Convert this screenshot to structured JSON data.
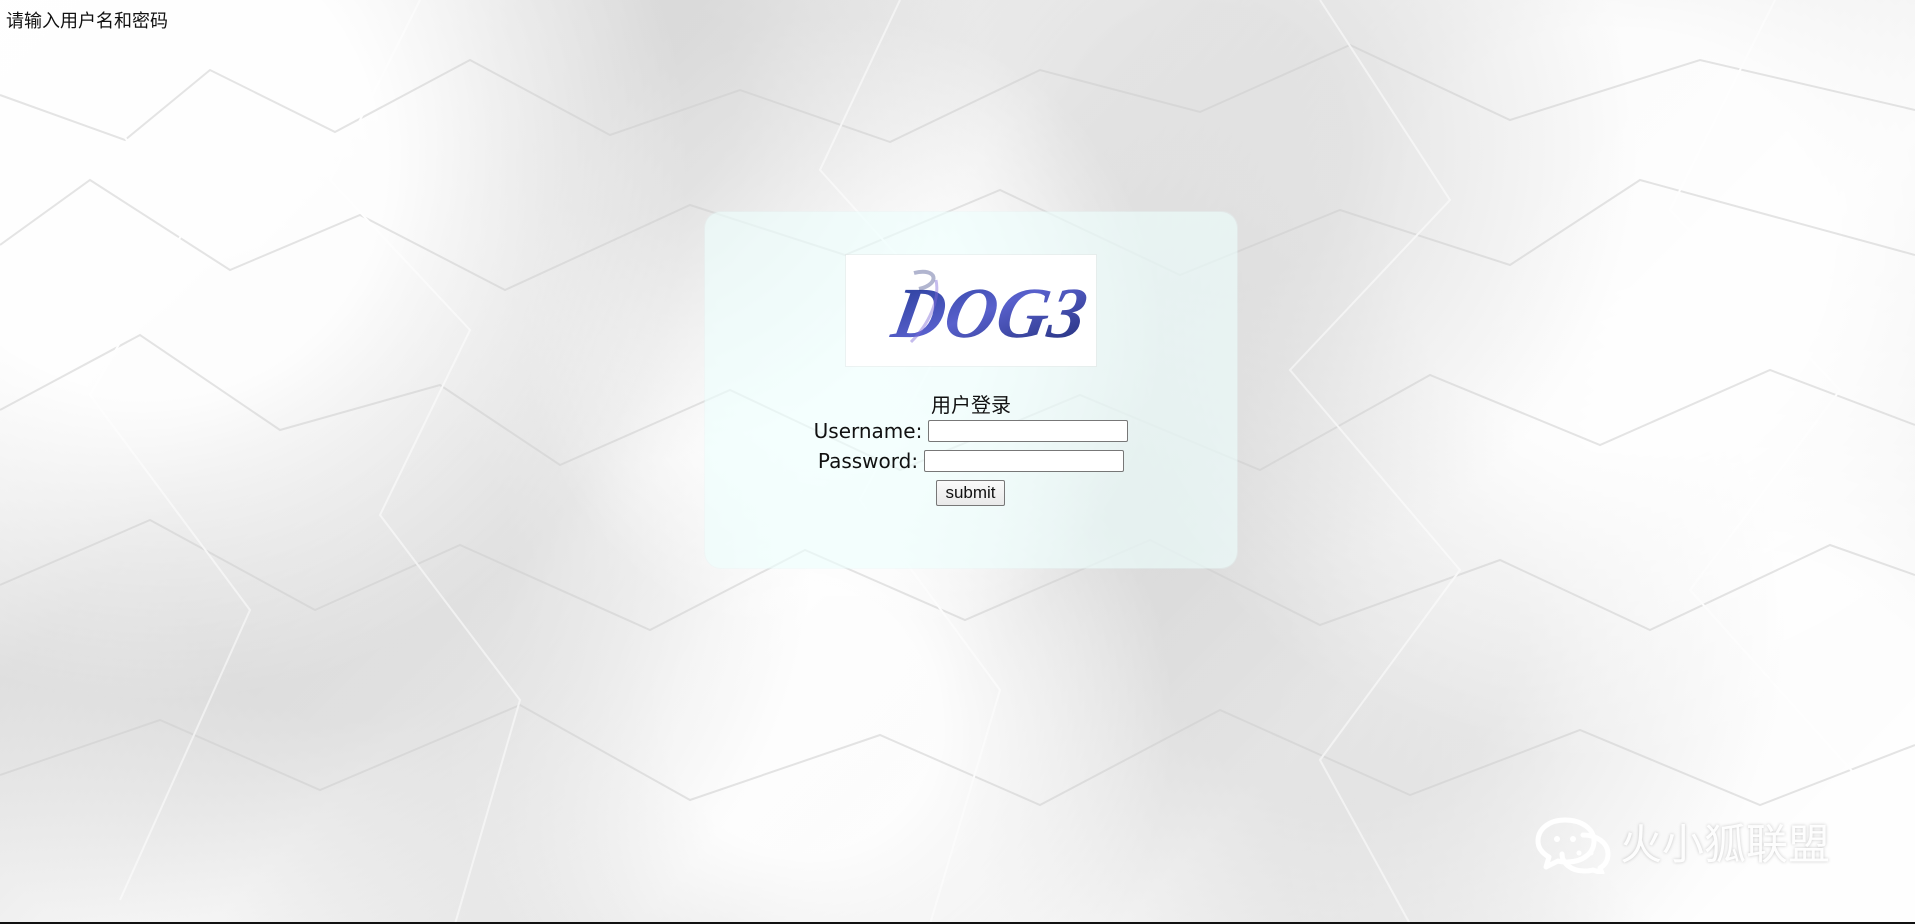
{
  "page": {
    "top_text": "请输入用户名和密码"
  },
  "logo": {
    "text": "DOG3"
  },
  "login": {
    "title": "用户登录",
    "username_label": "Username:",
    "username_value": "",
    "password_label": "Password:",
    "password_value": "",
    "submit_label": "submit"
  },
  "watermark": {
    "text": "火小狐联盟"
  },
  "icons": {
    "wechat": "wechat-icon"
  },
  "colors": {
    "panel": "#eefffe",
    "logo": "#2c3e95",
    "text": "#111111"
  }
}
